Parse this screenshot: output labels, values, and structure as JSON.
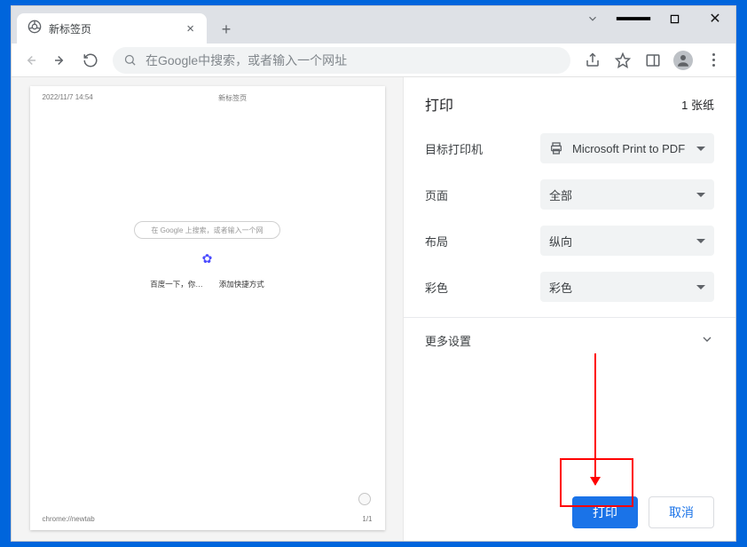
{
  "tab": {
    "title": "新标签页"
  },
  "omnibox": {
    "placeholder": "在Google中搜索，或者输入一个网址"
  },
  "preview": {
    "timestamp": "2022/11/7 14:54",
    "page_name": "新标签页",
    "mini_search": "在 Google 上搜索，或者输入一个网",
    "shortcut_left": "百度一下，你…",
    "shortcut_right": "添加快捷方式",
    "footer_left": "chrome://newtab",
    "footer_right": "1/1"
  },
  "print": {
    "title": "打印",
    "page_count": "1 张纸",
    "destination_label": "目标打印机",
    "destination_value": "Microsoft Print to PDF",
    "pages_label": "页面",
    "pages_value": "全部",
    "layout_label": "布局",
    "layout_value": "纵向",
    "color_label": "彩色",
    "color_value": "彩色",
    "more_settings": "更多设置",
    "print_btn": "打印",
    "cancel_btn": "取消"
  }
}
